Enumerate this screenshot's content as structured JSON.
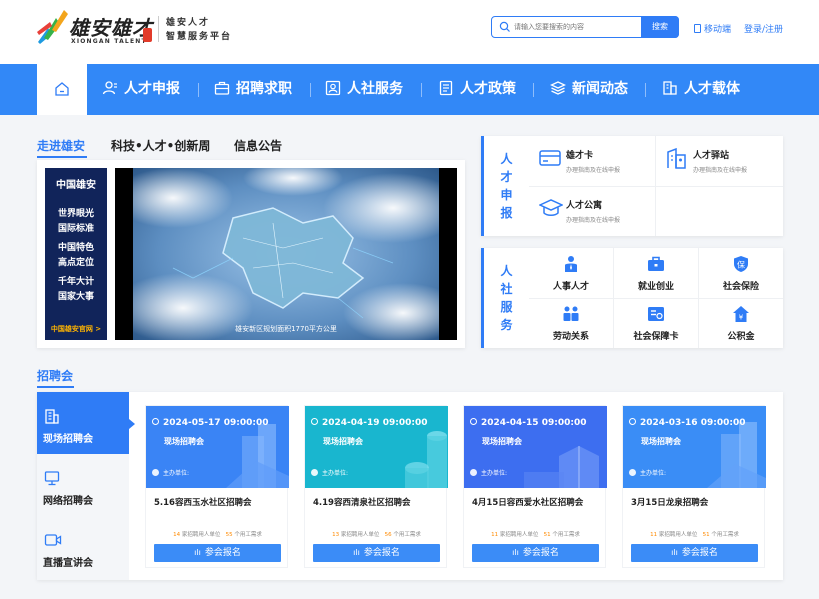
{
  "header": {
    "logo_cn": "雄安雄才",
    "logo_en": "XIONGAN TALENT",
    "logo_sub_1": "雄安人才",
    "logo_sub_2": "智慧服务平台",
    "search_placeholder": "请输入您要搜索的内容",
    "search_button": "搜索",
    "mobile_link": "移动端",
    "login_link": "登录/注册"
  },
  "nav": {
    "items": [
      {
        "label": "人才申报",
        "icon": "user-icon"
      },
      {
        "label": "招聘求职",
        "icon": "briefcase-icon"
      },
      {
        "label": "人社服务",
        "icon": "id-card-icon"
      },
      {
        "label": "人才政策",
        "icon": "document-icon"
      },
      {
        "label": "新闻动态",
        "icon": "layers-icon"
      },
      {
        "label": "人才载体",
        "icon": "building-icon"
      }
    ]
  },
  "news": {
    "tabs": [
      "走进雄安",
      "科技•人才•创新周",
      "信息公告"
    ],
    "banner_top": "中国雄安",
    "banner_lines": [
      "世界眼光",
      "国际标准",
      "中国特色",
      "高点定位",
      "千年大计",
      "国家大事"
    ],
    "banner_bottom": "中国雄安官网 >",
    "video_caption": "雄安新区规划面积1770平方公里"
  },
  "apply": {
    "label": [
      "人",
      "才",
      "申",
      "报"
    ],
    "items": [
      {
        "title": "雄才卡",
        "desc": "办理指南及在线申报",
        "icon": "card-icon"
      },
      {
        "title": "人才驿站",
        "desc": "办理指南及在线申报",
        "icon": "station-icon"
      },
      {
        "title": "人才公寓",
        "desc": "办理指南及在线申报",
        "icon": "graduation-cap-icon"
      }
    ]
  },
  "service": {
    "label": [
      "人",
      "社",
      "服",
      "务"
    ],
    "items": [
      {
        "title": "人事人才",
        "icon": "personnel-icon"
      },
      {
        "title": "就业创业",
        "icon": "briefcase-icon"
      },
      {
        "title": "社会保险",
        "icon": "shield-icon"
      },
      {
        "title": "劳动关系",
        "icon": "people-icon"
      },
      {
        "title": "社会保障卡",
        "icon": "social-card-icon"
      },
      {
        "title": "公积金",
        "icon": "house-icon"
      }
    ]
  },
  "fair": {
    "title": "招聘会",
    "tabs": [
      "现场招聘会",
      "网络招聘会",
      "直播宣讲会"
    ],
    "stat_units_label": "家招聘用人单位",
    "stat_jobs_label": "个用工需求",
    "host_label": "主办单位:",
    "apply_button": "参会报名",
    "cards": [
      {
        "date": "2024-05-17 09:00:00",
        "type": "现场招聘会",
        "title": "5.16容西玉水社区招聘会",
        "units": "14",
        "jobs": "55"
      },
      {
        "date": "2024-04-19 09:00:00",
        "type": "现场招聘会",
        "title": "4.19容西清泉社区招聘会",
        "units": "13",
        "jobs": "56"
      },
      {
        "date": "2024-04-15 09:00:00",
        "type": "现场招聘会",
        "title": "4月15日容西爱水社区招聘会",
        "units": "11",
        "jobs": "51"
      },
      {
        "date": "2024-03-16 09:00:00",
        "type": "现场招聘会",
        "title": "3月15日龙泉招聘会",
        "units": "11",
        "jobs": "51"
      }
    ]
  },
  "colors": {
    "primary": "#2f7cf6",
    "nav_bg": "#3288f7",
    "card1": "#3a84f5",
    "card2": "#19b6cf",
    "card3": "#3d6ef0",
    "card4": "#3a8df6",
    "accent_orange": "#ff8a00",
    "banner_navy": "#11245a"
  }
}
